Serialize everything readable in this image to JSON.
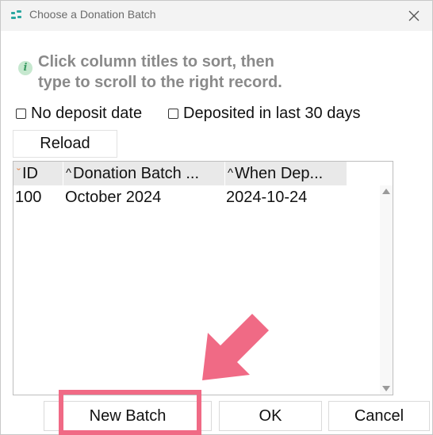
{
  "window": {
    "title": "Choose a Donation Batch",
    "close_icon": "close-icon",
    "app_icon": "app-logo-icon"
  },
  "hint": {
    "icon": "info-icon",
    "icon_glyph": "i",
    "line1": "Click column titles to sort, then",
    "line2": "type to scroll to the right record."
  },
  "filters": {
    "no_deposit_date": {
      "label": "No deposit date",
      "checked": false
    },
    "deposited_last_30": {
      "label": "Deposited in last 30 days",
      "checked": false
    }
  },
  "reload_label": "Reload",
  "table": {
    "columns": [
      {
        "label": "ID",
        "sort": "desc",
        "sort_glyph": "ˇ"
      },
      {
        "label": "Donation Batch ...",
        "sort": "asc",
        "sort_glyph": "^"
      },
      {
        "label": "When Dep...",
        "sort": "asc",
        "sort_glyph": "^"
      }
    ],
    "rows": [
      {
        "id": "100",
        "batch": "October 2024",
        "when": "2024-10-24"
      }
    ]
  },
  "buttons": {
    "new_batch": "New Batch",
    "ok": "OK",
    "cancel": "Cancel"
  },
  "colors": {
    "annotation": "#f06a85",
    "hint_text": "#8a8a8a",
    "info_icon_bg": "#c6e8cf",
    "sort_desc": "#e07a3c"
  }
}
